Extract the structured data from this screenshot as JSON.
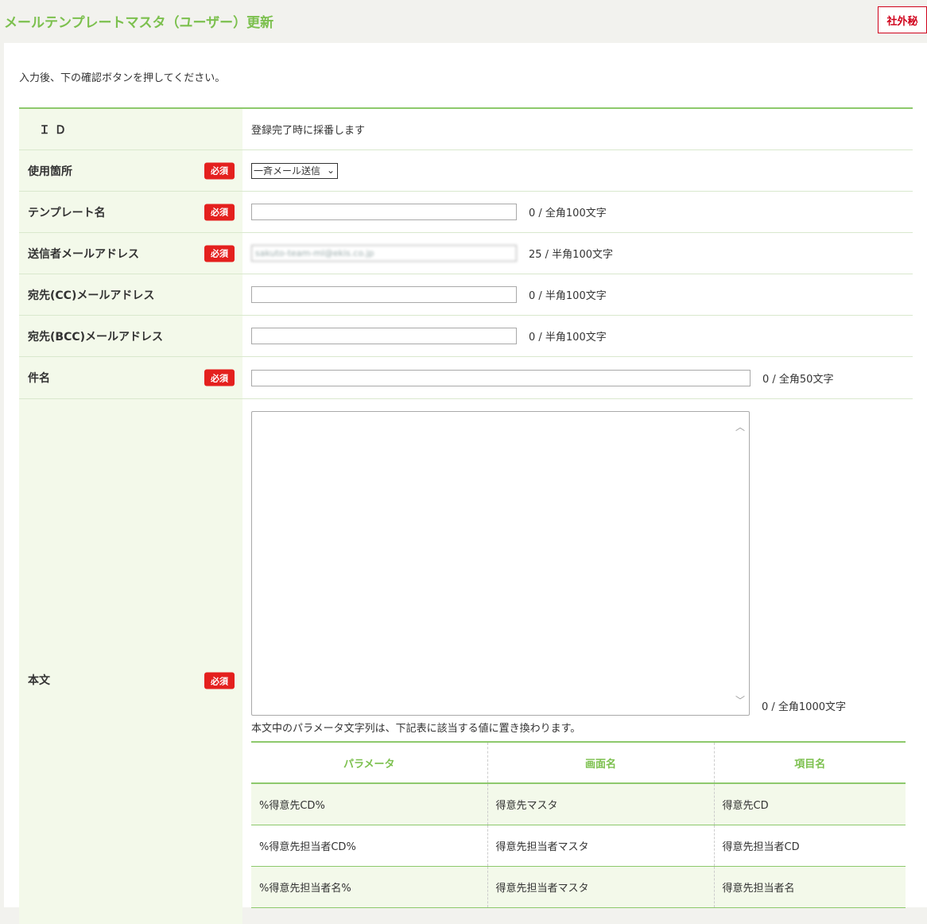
{
  "header": {
    "title": "メールテンプレートマスタ（ユーザー）更新",
    "confidential": "社外秘"
  },
  "instruction": "入力後、下の確認ボタンを押してください。",
  "required_label": "必須",
  "form": {
    "id": {
      "label": "ＩＤ",
      "value": "登録完了時に採番します"
    },
    "usage": {
      "label": "使用箇所",
      "selected": "一斉メール送信"
    },
    "template_name": {
      "label": "テンプレート名",
      "value": "",
      "counter": "0 / 全角100文字"
    },
    "sender": {
      "label": "送信者メールアドレス",
      "value": "sakuto-team-ml@ekis.co.jp",
      "counter": "25 / 半角100文字"
    },
    "cc": {
      "label": "宛先(CC)メールアドレス",
      "value": "",
      "counter": "0 / 半角100文字"
    },
    "bcc": {
      "label": "宛先(BCC)メールアドレス",
      "value": "",
      "counter": "0 / 半角100文字"
    },
    "subject": {
      "label": "件名",
      "value": "",
      "counter": "0 / 全角50文字"
    },
    "body": {
      "label": "本文",
      "value": "",
      "counter": "0 / 全角1000文字",
      "note": "本文中のパラメータ文字列は、下記表に該当する値に置き換わります。"
    }
  },
  "param_table": {
    "headers": [
      "パラメータ",
      "画面名",
      "項目名"
    ],
    "rows": [
      [
        "%得意先CD%",
        "得意先マスタ",
        "得意先CD"
      ],
      [
        "%得意先担当者CD%",
        "得意先担当者マスタ",
        "得意先担当者CD"
      ],
      [
        "%得意先担当者名%",
        "得意先担当者マスタ",
        "得意先担当者名"
      ]
    ]
  }
}
